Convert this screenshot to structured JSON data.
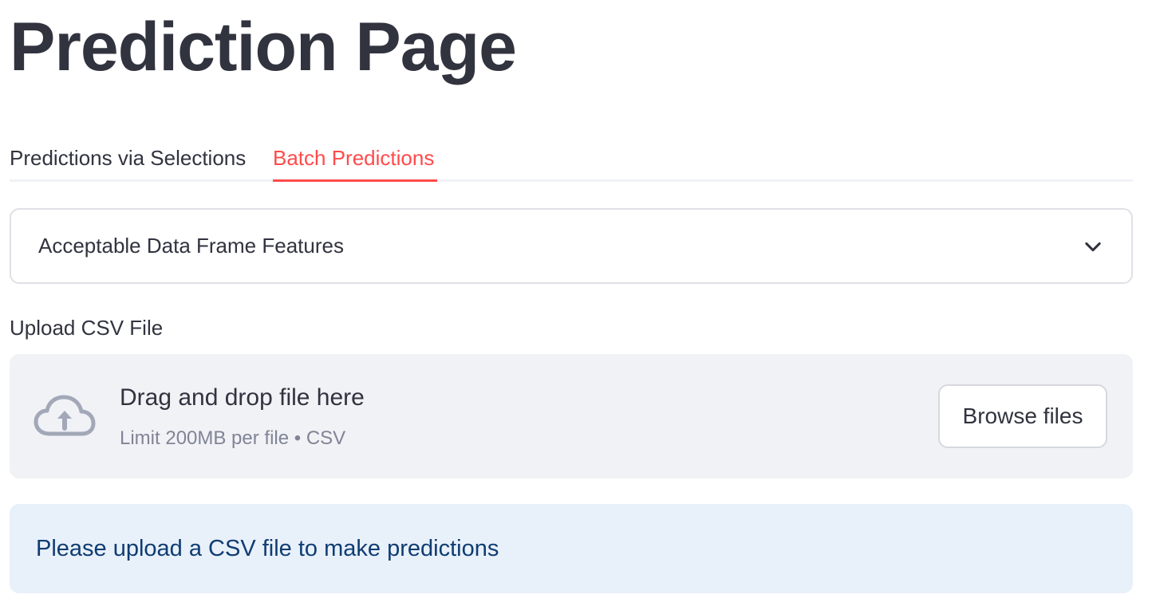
{
  "page": {
    "title": "Prediction Page"
  },
  "tabs": [
    {
      "label": "Predictions via Selections",
      "active": false
    },
    {
      "label": "Batch Predictions",
      "active": true
    }
  ],
  "expander": {
    "label": "Acceptable Data Frame Features",
    "icon": "chevron-down-icon"
  },
  "uploader": {
    "label": "Upload CSV File",
    "drop_text": "Drag and drop file here",
    "limit_text": "Limit 200MB per file • CSV",
    "browse_label": "Browse files",
    "icon": "cloud-upload-icon"
  },
  "info": {
    "message": "Please upload a CSV file to make predictions"
  },
  "colors": {
    "accent": "#ff4b4b",
    "text": "#31333f",
    "muted": "#808495",
    "dropzone_bg": "#f0f2f6",
    "info_bg": "#e8f0fa",
    "info_text": "#0f3c72"
  }
}
